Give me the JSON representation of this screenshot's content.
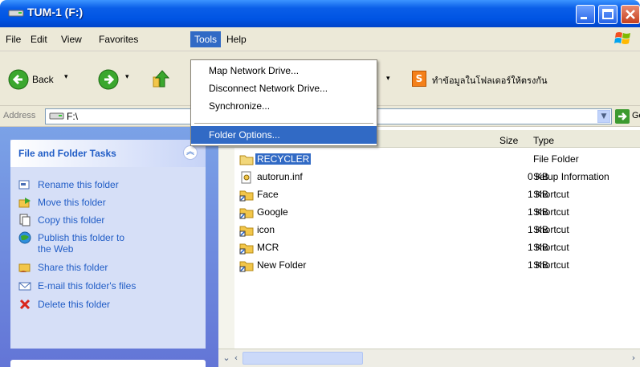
{
  "window": {
    "title": "TUM-1 (F:)"
  },
  "menubar": {
    "items": [
      {
        "label": "File"
      },
      {
        "label": "Edit"
      },
      {
        "label": "View"
      },
      {
        "label": "Favorites"
      },
      {
        "label": "Tools"
      },
      {
        "label": "Help"
      }
    ]
  },
  "tools_menu": {
    "items": [
      {
        "label": "Map Network Drive..."
      },
      {
        "label": "Disconnect Network Drive..."
      },
      {
        "label": "Synchronize..."
      },
      {
        "label": "Folder Options..."
      }
    ],
    "highlighted_index": 3
  },
  "toolbar": {
    "back_label": "Back",
    "thai_button_label": "ทำข้อมูลในโฟลเดอร์ให้ตรงกัน",
    "thai_button_icon": "S"
  },
  "address": {
    "label": "Address",
    "value": "F:\\",
    "go_label": "Go"
  },
  "tasks": {
    "title": "File and Folder Tasks",
    "items": [
      {
        "label": "Rename this folder",
        "icon": "rename-icon"
      },
      {
        "label": "Move this folder",
        "icon": "move-icon"
      },
      {
        "label": "Copy this folder",
        "icon": "copy-icon"
      },
      {
        "label": "Publish this folder to",
        "label2": "the Web",
        "icon": "publish-icon"
      },
      {
        "label": "Share this folder",
        "icon": "share-icon"
      },
      {
        "label": "E-mail this folder's files",
        "icon": "email-icon"
      },
      {
        "label": "Delete this folder",
        "icon": "delete-icon"
      }
    ]
  },
  "filelist": {
    "columns": {
      "size": "Size",
      "type": "Type"
    },
    "files": [
      {
        "name": "RECYCLER",
        "size": "",
        "type": "File Folder",
        "selected": true
      },
      {
        "name": "autorun.inf",
        "size": "0 KB",
        "type": "Setup Information"
      },
      {
        "name": "Face",
        "size": "1 KB",
        "type": "Shortcut"
      },
      {
        "name": "Google",
        "size": "1 KB",
        "type": "Shortcut"
      },
      {
        "name": "icon",
        "size": "1 KB",
        "type": "Shortcut"
      },
      {
        "name": "MCR",
        "size": "1 KB",
        "type": "Shortcut"
      },
      {
        "name": "New Folder",
        "size": "1 KB",
        "type": "Shortcut"
      }
    ]
  },
  "colors": {
    "titlebar": "#0054e3",
    "selection": "#316ac5",
    "taskpane": "#7ba2e7",
    "task_text": "#215dc6"
  }
}
